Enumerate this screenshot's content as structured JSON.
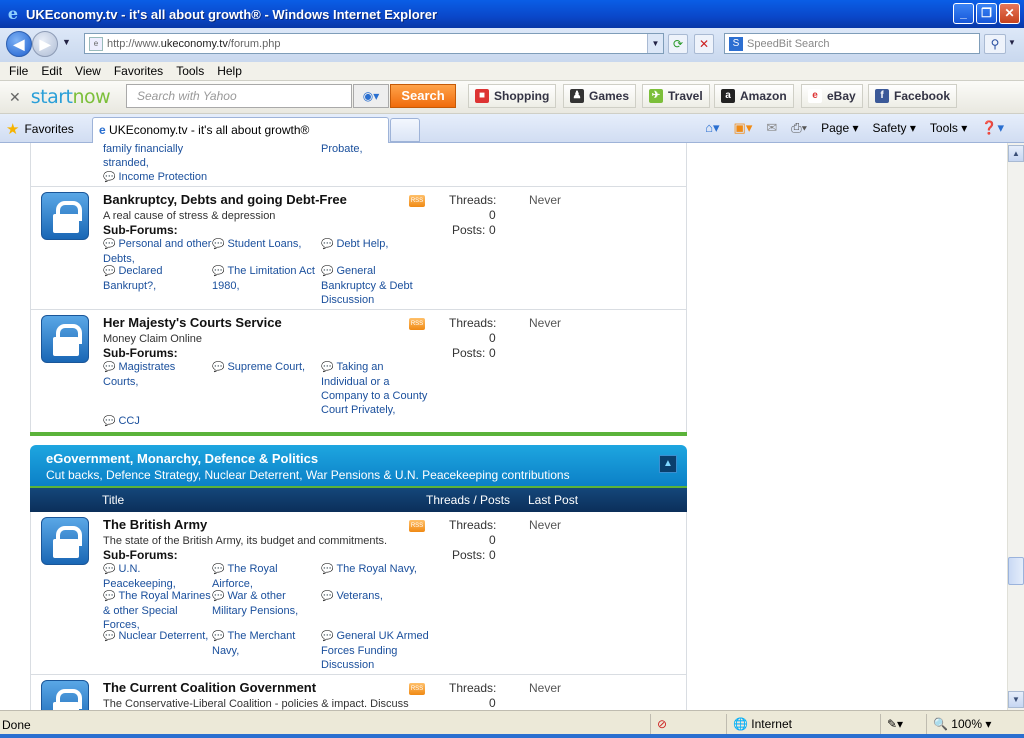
{
  "window": {
    "title": "UKEconomy.tv - it's all about growth® - Windows Internet Explorer"
  },
  "address": {
    "url_prefix": "http://www.",
    "url_host": "ukeconomy.tv",
    "url_path": "/forum.php"
  },
  "speedbit": {
    "placeholder": "SpeedBit Search"
  },
  "menu": [
    "File",
    "Edit",
    "View",
    "Favorites",
    "Tools",
    "Help"
  ],
  "startnow": {
    "logo_a": "start",
    "logo_b": "now",
    "search_placeholder": "Search with Yahoo",
    "search_label": "Search",
    "links": [
      "Shopping",
      "Games",
      "Travel",
      "Amazon",
      "eBay",
      "Facebook"
    ]
  },
  "tabs": {
    "favorites": "Favorites",
    "active_tab": "UKEconomy.tv - it's all about growth®"
  },
  "commands": [
    "Page ▾",
    "Safety ▾",
    "Tools ▾"
  ],
  "top_partial": {
    "left_a": "family financially",
    "left_b": "stranded,",
    "income": "Income Protection",
    "probate": "Probate,"
  },
  "forums_a": [
    {
      "title": "Bankruptcy, Debts and going Debt-Free",
      "desc": "A real cause of stress & depression",
      "sub_label": "Sub-Forums:",
      "subs": [
        "Personal and other",
        "Debts,",
        "Student Loans,",
        "Debt Help,",
        "Declared",
        "Bankrupt?,",
        "The Limitation Act",
        "1980,",
        "General",
        "Bankruptcy & Debt",
        "Discussion"
      ],
      "threads_label": "Threads:",
      "threads": "0",
      "posts_label": "Posts:",
      "posts": "0",
      "last": "Never"
    },
    {
      "title": "Her Majesty's Courts Service",
      "desc": "Money Claim Online",
      "sub_label": "Sub-Forums:",
      "subs": [
        "Magistrates",
        "Courts,",
        "Supreme Court,",
        "Taking an",
        "Individual or a",
        "Company to a County",
        "Court Privately,",
        "CCJ"
      ],
      "threads_label": "Threads:",
      "threads": "0",
      "posts_label": "Posts:",
      "posts": "0",
      "last": "Never"
    }
  ],
  "category": {
    "title": "eGovernment, Monarchy, Defence & Politics",
    "desc": "Cut backs, Defence Strategy, Nuclear Deterrent, War Pensions & U.N. Peacekeeping contributions",
    "col_title": "Title",
    "col_threads": "Threads / Posts",
    "col_last": "Last Post"
  },
  "forums_b": [
    {
      "title": "The British Army",
      "desc": "The state of the British Army, its budget and commitments.",
      "sub_label": "Sub-Forums:",
      "subs": [
        "U.N.",
        "Peacekeeping,",
        "The Royal",
        "Airforce,",
        "The Royal Navy,",
        "The Royal Marines",
        "& other Special",
        "Forces,",
        "War & other",
        "Military Pensions,",
        "Veterans,",
        "Nuclear Deterrent,",
        "The Merchant",
        "Navy,",
        "General UK Armed",
        "Forces Funding",
        "Discussion"
      ],
      "threads_label": "Threads:",
      "threads": "0",
      "posts_label": "Posts:",
      "posts": "0",
      "last": "Never"
    },
    {
      "title": "The Current Coalition Government",
      "desc": "The Conservative-Liberal Coalition - policies & impact. Discuss",
      "threads_label": "Threads:",
      "threads": "0",
      "last": "Never"
    }
  ],
  "status": {
    "done": "Done",
    "zone": "Internet",
    "zoom": "100%"
  },
  "colors": {
    "category_blue": "#0b7fc6",
    "column_navy": "#0b2f5a",
    "divider_green": "#5bb33a",
    "link": "#1a4f9c"
  }
}
